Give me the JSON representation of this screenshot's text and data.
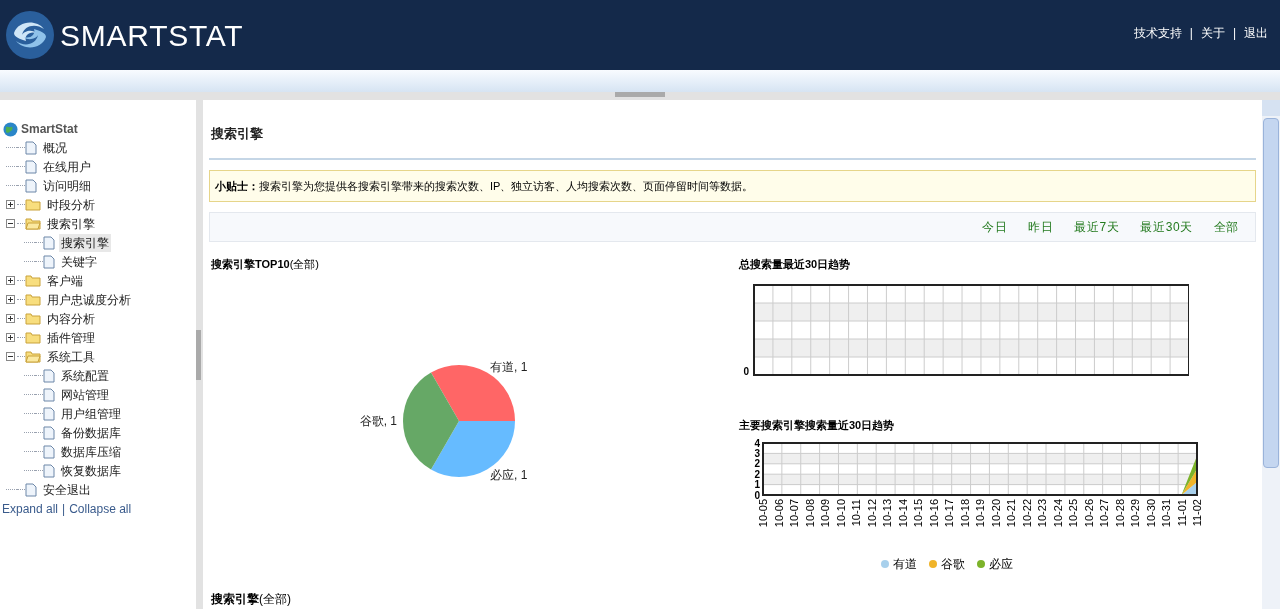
{
  "header": {
    "logo": "SMARTSTAT",
    "links": [
      {
        "label": "技术支持"
      },
      {
        "label": "关于"
      },
      {
        "label": "退出"
      }
    ],
    "separator": "|"
  },
  "sidebar": {
    "root": "SmartStat",
    "items": [
      {
        "label": "概况",
        "kind": "page",
        "selected": false
      },
      {
        "label": "在线用户",
        "kind": "page",
        "selected": false
      },
      {
        "label": "访问明细",
        "kind": "page",
        "selected": false
      },
      {
        "label": "时段分析",
        "kind": "folder",
        "expanded": false,
        "selected": false
      },
      {
        "label": "搜索引擎",
        "kind": "folder",
        "expanded": true,
        "selected": false,
        "children": [
          {
            "label": "搜索引擎",
            "kind": "page",
            "selected": true
          },
          {
            "label": "关键字",
            "kind": "page",
            "selected": false
          }
        ]
      },
      {
        "label": "客户端",
        "kind": "folder",
        "expanded": false,
        "selected": false
      },
      {
        "label": "用户忠诚度分析",
        "kind": "folder",
        "expanded": false,
        "selected": false
      },
      {
        "label": "内容分析",
        "kind": "folder",
        "expanded": false,
        "selected": false
      },
      {
        "label": "插件管理",
        "kind": "folder",
        "expanded": false,
        "selected": false
      },
      {
        "label": "系统工具",
        "kind": "folder",
        "expanded": true,
        "selected": false,
        "children": [
          {
            "label": "系统配置",
            "kind": "page",
            "selected": false
          },
          {
            "label": "网站管理",
            "kind": "page",
            "selected": false
          },
          {
            "label": "用户组管理",
            "kind": "page",
            "selected": false
          },
          {
            "label": "备份数据库",
            "kind": "page",
            "selected": false
          },
          {
            "label": "数据库压缩",
            "kind": "page",
            "selected": false
          },
          {
            "label": "恢复数据库",
            "kind": "page",
            "selected": false
          }
        ]
      },
      {
        "label": "安全退出",
        "kind": "page",
        "selected": false
      }
    ],
    "expand_all": "Expand all",
    "separator": "|",
    "collapse_all": "Collapse all"
  },
  "main": {
    "title": "搜索引擎",
    "tip": "**小贴士：**搜索引擎为您提供各搜索引擎带来的搜索次数、IP、独立访客、人均搜索次数、页面停留时间等数据。",
    "ranges": [
      {
        "label": "今日"
      },
      {
        "label": "昨日"
      },
      {
        "label": "最近7天"
      },
      {
        "label": "最近30天"
      },
      {
        "label": "全部"
      }
    ],
    "pie": {
      "title": "**搜索引擎TOP10**(全部)",
      "chart_data": {
        "type": "pie",
        "values": [
          1,
          1,
          1
        ],
        "value_labels": [
          "有道, 1",
          "必应, 1",
          "谷歌, 1"
        ]
      }
    },
    "total_trend": {
      "title": "总搜索量最近30日趋势",
      "zero": "0"
    },
    "engine_trend": {
      "title": "主要搜索引擎搜索量近30日趋势",
      "chart_data": {
        "type": "area",
        "stacked": true,
        "grid": true,
        "categories": [
          "10-05",
          "10-06",
          "10-07",
          "10-08",
          "10-09",
          "10-10",
          "10-11",
          "10-12",
          "10-13",
          "10-14",
          "10-15",
          "10-16",
          "10-17",
          "10-18",
          "10-19",
          "10-20",
          "10-21",
          "10-22",
          "10-23",
          "10-24",
          "10-25",
          "10-26",
          "10-27",
          "10-28",
          "10-29",
          "10-30",
          "10-31",
          "11-01",
          "11-02"
        ],
        "ylim": [
          0,
          4
        ],
        "yticks": [
          {
            "value": 0,
            "label": "0"
          },
          {
            "value": 0.8,
            "label": "1"
          },
          {
            "value": 1.6,
            "label": "2"
          },
          {
            "value": 2.4,
            "label": "2"
          },
          {
            "value": 3.2,
            "label": "3"
          },
          {
            "value": 4,
            "label": "4"
          }
        ],
        "series": [
          {
            "name": "有道",
            "color": "#a8d0ec",
            "values": [
              0,
              0,
              0,
              0,
              0,
              0,
              0,
              0,
              0,
              0,
              0,
              0,
              0,
              0,
              0,
              0,
              0,
              0,
              0,
              0,
              0,
              0,
              0,
              0,
              0,
              0,
              0,
              0,
              1
            ]
          },
          {
            "name": "谷歌",
            "color": "#f0b429",
            "values": [
              0,
              0,
              0,
              0,
              0,
              0,
              0,
              0,
              0,
              0,
              0,
              0,
              0,
              0,
              0,
              0,
              0,
              0,
              0,
              0,
              0,
              0,
              0,
              0,
              0,
              0,
              0,
              0,
              1
            ]
          },
          {
            "name": "必应",
            "color": "#7cb32a",
            "values": [
              0,
              0,
              0,
              0,
              0,
              0,
              0,
              0,
              0,
              0,
              0,
              0,
              0,
              0,
              0,
              0,
              0,
              0,
              0,
              0,
              0,
              0,
              0,
              0,
              0,
              0,
              0,
              0,
              1
            ]
          }
        ]
      }
    },
    "bottom_title": "**搜索引擎**(全部)"
  }
}
